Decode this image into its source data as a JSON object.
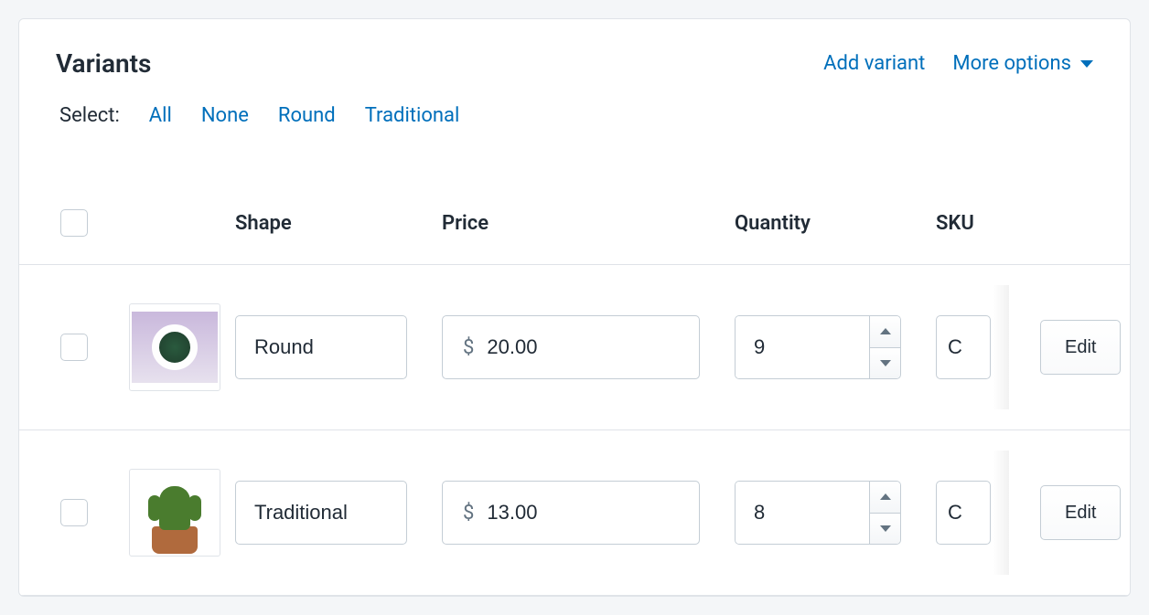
{
  "header": {
    "title": "Variants",
    "add_variant": "Add variant",
    "more_options": "More options"
  },
  "select_row": {
    "label": "Select:",
    "all": "All",
    "none": "None",
    "opt1": "Round",
    "opt2": "Traditional"
  },
  "columns": {
    "shape": "Shape",
    "price": "Price",
    "quantity": "Quantity",
    "sku": "SKU"
  },
  "currency_symbol": "$",
  "rows": [
    {
      "shape": "Round",
      "price": "20.00",
      "quantity": "9",
      "sku": "C",
      "edit": "Edit"
    },
    {
      "shape": "Traditional",
      "price": "13.00",
      "quantity": "8",
      "sku": "C",
      "edit": "Edit"
    }
  ]
}
